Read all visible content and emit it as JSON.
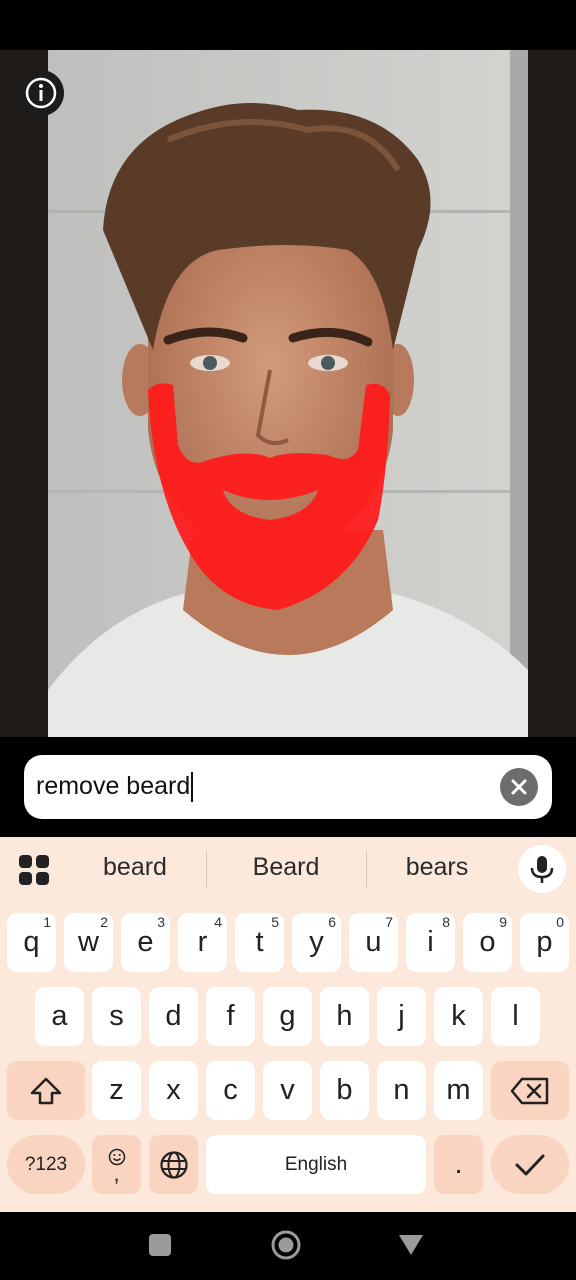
{
  "photo": {
    "alt_icon": "info-icon"
  },
  "prompt": {
    "value": "remove beard"
  },
  "suggestions": [
    "beard",
    "Beard",
    "bears"
  ],
  "keys_row1": [
    {
      "k": "q",
      "h": "1"
    },
    {
      "k": "w",
      "h": "2"
    },
    {
      "k": "e",
      "h": "3"
    },
    {
      "k": "r",
      "h": "4"
    },
    {
      "k": "t",
      "h": "5"
    },
    {
      "k": "y",
      "h": "6"
    },
    {
      "k": "u",
      "h": "7"
    },
    {
      "k": "i",
      "h": "8"
    },
    {
      "k": "o",
      "h": "9"
    },
    {
      "k": "p",
      "h": "0"
    }
  ],
  "keys_row2": [
    "a",
    "s",
    "d",
    "f",
    "g",
    "h",
    "j",
    "k",
    "l"
  ],
  "keys_row3": [
    "z",
    "x",
    "c",
    "v",
    "b",
    "n",
    "m"
  ],
  "bottom_row": {
    "symbols": "?123",
    "emoji_comma": ",",
    "space": "English",
    "period": "."
  },
  "colors": {
    "keyboard_bg": "#fde8dc",
    "key_bg": "#ffffff",
    "accent_key": "#f9d4c1",
    "mask": "#ff1a1a"
  }
}
